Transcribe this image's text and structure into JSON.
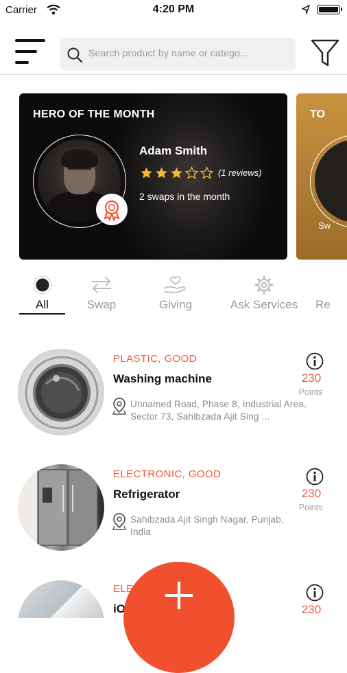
{
  "status_bar": {
    "carrier": "Carrier",
    "time": "4:20 PM"
  },
  "header": {
    "search_placeholder": "Search product by name or catego..."
  },
  "banner": {
    "hero": {
      "title": "HERO OF THE MONTH",
      "name": "Adam Smith",
      "rating": 3,
      "max_rating": 5,
      "reviews": "(1 reviews)",
      "swaps": "2 swaps in the month"
    },
    "next": {
      "title_fragment": "TO",
      "swaps_fragment": "Sw"
    }
  },
  "tabs": [
    {
      "label": "All",
      "icon": "all-dot-icon",
      "active": true
    },
    {
      "label": "Swap",
      "icon": "swap-arrows-icon",
      "active": false
    },
    {
      "label": "Giving",
      "icon": "giving-hand-icon",
      "active": false
    },
    {
      "label": "Ask Services",
      "icon": "gear-icon",
      "active": false
    },
    {
      "label": "Re",
      "icon": "",
      "active": false
    }
  ],
  "items": [
    {
      "category": "PLASTIC, GOOD",
      "title": "Washing machine",
      "address_line1": "Unnamed Road, Phase 8, Industrial Area,",
      "address_line2": "Sector 73, Sahibzada Ajit Sing ...",
      "points": "230",
      "points_label": "Points"
    },
    {
      "category": "ELECTRONIC, GOOD",
      "title": "Refrigerator",
      "address_line1": "Sahibzada Ajit Singh Nagar, Punjab,",
      "address_line2": "India",
      "points": "230",
      "points_label": "Points"
    },
    {
      "category": "ELE",
      "title": "iO",
      "points": "230"
    }
  ],
  "colors": {
    "accent": "#f0502e",
    "category": "#ee5a3a",
    "star": "#f5b82e"
  }
}
